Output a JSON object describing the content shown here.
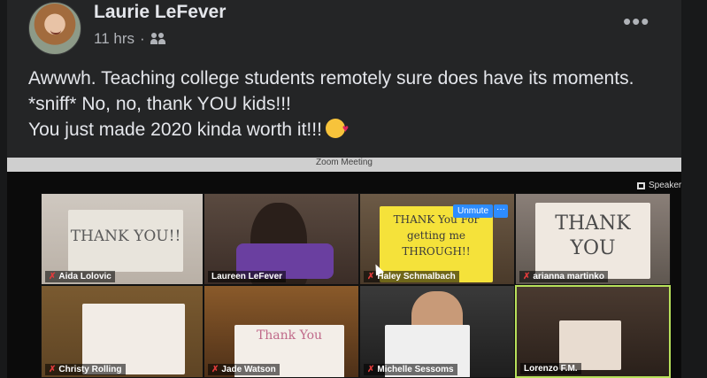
{
  "post": {
    "author": "Laurie LeFever",
    "time": "11 hrs",
    "separator": "·",
    "audience_icon": "people-icon",
    "more_icon": "more-options-icon",
    "more_label": "•••",
    "text_line1": "Awwwh. Teaching college students remotely sure does have its moments. *sniff* No, no, thank YOU kids!!!",
    "text_line2": "You just made 2020 kinda worth it!!!",
    "emoji": "face-blowing-kiss-emoji"
  },
  "zoom": {
    "window_title": "Zoom Meeting",
    "speaker_view_label": "Speaker",
    "unmute_label": "Unmute",
    "unmute_more_label": "···",
    "participants": [
      {
        "name": "Aida Lolovic",
        "muted": true,
        "sign": "THANK YOU!!"
      },
      {
        "name": "Laureen LeFever",
        "muted": false,
        "sign": ""
      },
      {
        "name": "Haley Schmalbach",
        "muted": true,
        "sign": "THANK You For getting me THROUGH!!"
      },
      {
        "name": "arianna martinko",
        "muted": true,
        "sign": "THANK YOU"
      },
      {
        "name": "Christy Rolling",
        "muted": true,
        "sign": ""
      },
      {
        "name": "Jade Watson",
        "muted": true,
        "sign": "Thank You"
      },
      {
        "name": "Michelle Sessoms",
        "muted": true,
        "sign": ""
      },
      {
        "name": "Lorenzo F.M.",
        "muted": false,
        "sign": ""
      }
    ],
    "colors": {
      "active_speaker_border": "#b7e05a",
      "unmute_button": "#2d8cff",
      "mute_icon": "#e03b3b"
    }
  }
}
